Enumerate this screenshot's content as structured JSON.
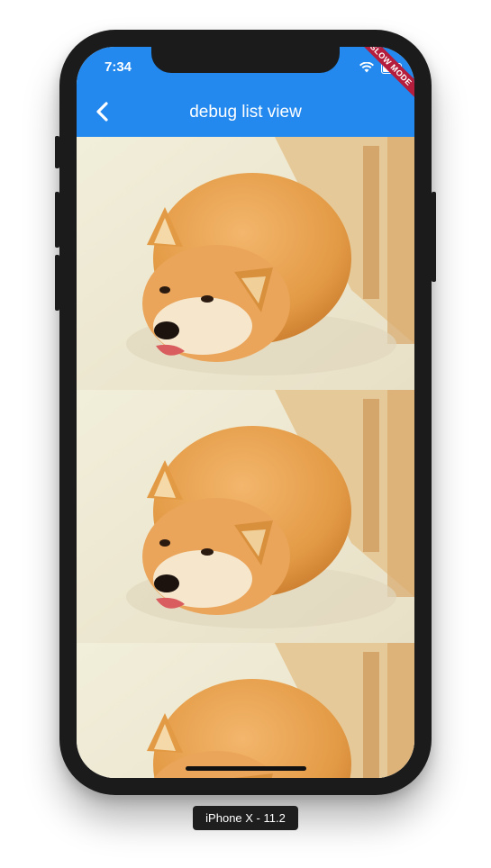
{
  "status_bar": {
    "time": "7:34"
  },
  "app_bar": {
    "title": "debug list view"
  },
  "debug_banner": "SLOW MODE",
  "list": {
    "items": [
      "shiba-photo",
      "shiba-photo",
      "shiba-photo"
    ]
  },
  "device_label": "iPhone X - 11.2",
  "colors": {
    "app_bar": "#2389ee",
    "banner": "#b51d3c",
    "device_frame": "#1b1b1b"
  }
}
